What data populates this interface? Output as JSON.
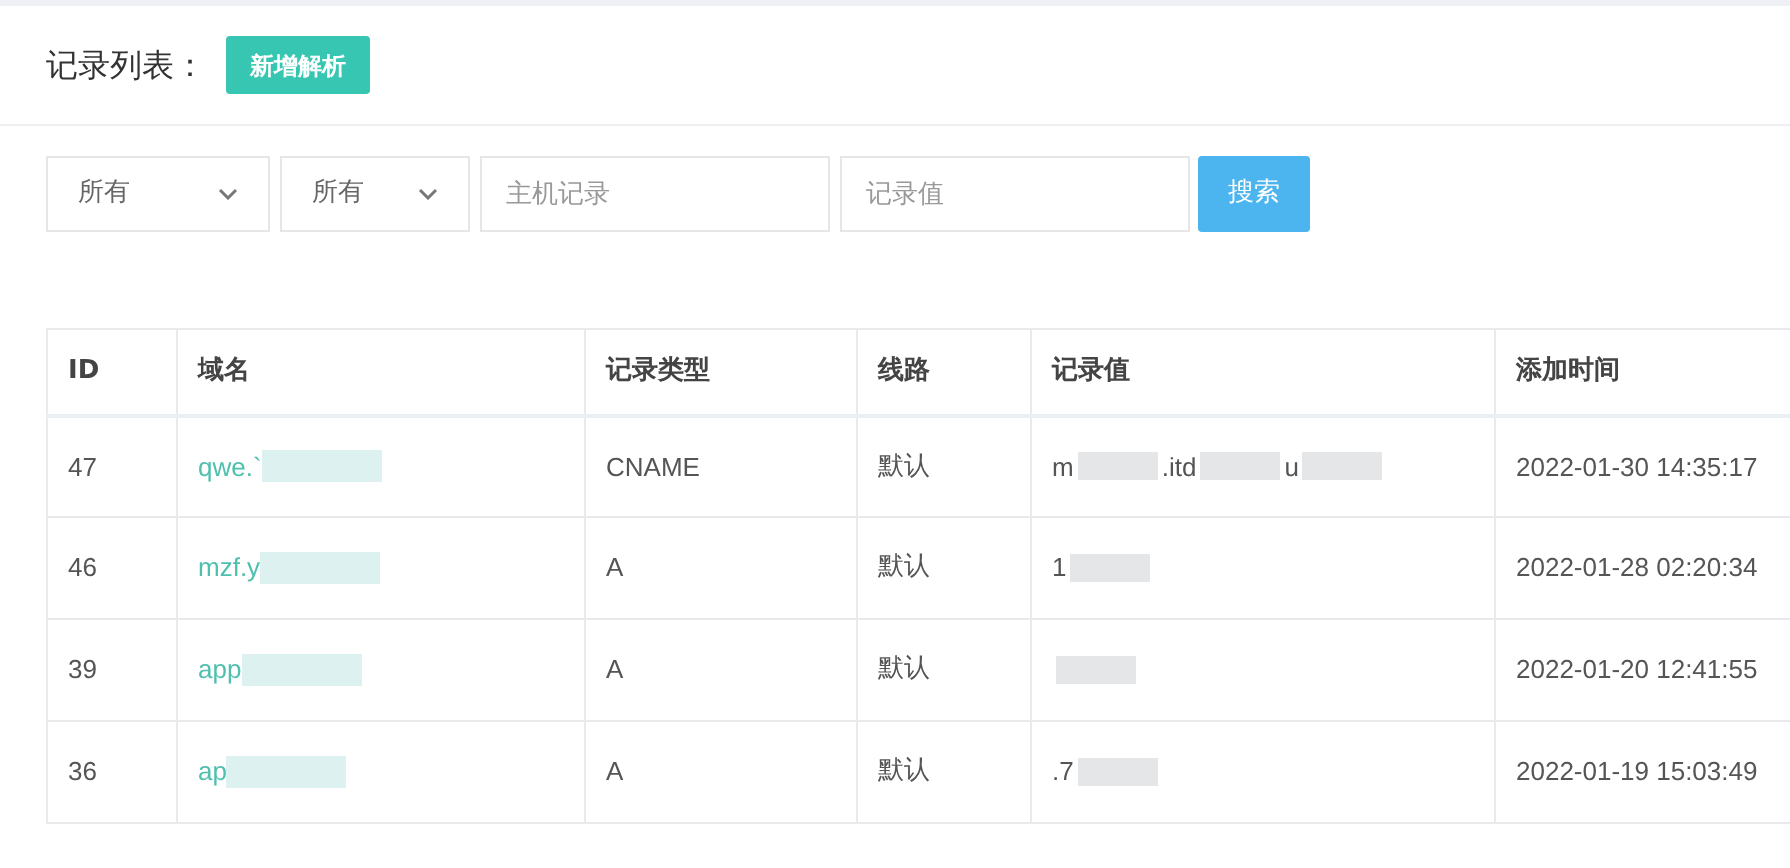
{
  "header": {
    "title": "记录列表：",
    "add_button": "新增解析"
  },
  "filters": {
    "selects": [
      {
        "value": "所有"
      },
      {
        "value": "所有"
      }
    ],
    "inputs": [
      {
        "placeholder": "主机记录"
      },
      {
        "placeholder": "记录值"
      }
    ],
    "search_button": "搜索"
  },
  "table": {
    "columns": [
      "ID",
      "域名",
      "记录类型",
      "线路",
      "记录值",
      "添加时间"
    ],
    "rows": [
      {
        "id": "47",
        "domain": "qwe.`",
        "type": "CNAME",
        "line": "默认",
        "value_parts": [
          "m",
          ".itd",
          "u"
        ],
        "time": "2022-01-30 14:35:17"
      },
      {
        "id": "46",
        "domain": "mzf.y",
        "type": "A",
        "line": "默认",
        "value_parts": [
          "1"
        ],
        "time": "2022-01-28 02:20:34"
      },
      {
        "id": "39",
        "domain": "app",
        "type": "A",
        "line": "默认",
        "value_parts": [],
        "time": "2022-01-20 12:41:55"
      },
      {
        "id": "36",
        "domain": "ap",
        "type": "A",
        "line": "默认",
        "value_parts": [
          ".7"
        ],
        "time": "2022-01-19 15:03:49"
      }
    ]
  }
}
